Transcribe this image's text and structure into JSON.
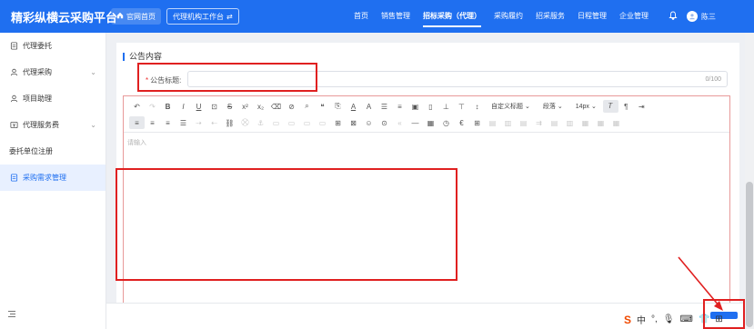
{
  "header": {
    "brand": "精彩纵横云采购平台",
    "home_btn": "官网首页",
    "workbench_btn": "代理机构工作台",
    "nav": [
      "首页",
      "销售管理",
      "招标采购（代理）",
      "采购履约",
      "招采服务",
      "日程管理",
      "企业管理"
    ],
    "active_nav_index": 2,
    "user_name": "陈三"
  },
  "sidebar": {
    "items": [
      {
        "label": "代理委托",
        "icon": "document-icon",
        "has_chevron": false
      },
      {
        "label": "代理采购",
        "icon": "user-icon",
        "has_chevron": true
      },
      {
        "label": "项目助理",
        "icon": "user-icon",
        "has_chevron": false
      },
      {
        "label": "代理服务费",
        "icon": "fee-icon",
        "has_chevron": true
      },
      {
        "label": "委托单位注册",
        "icon": "",
        "has_chevron": false
      },
      {
        "label": "采购需求管理",
        "icon": "document-icon",
        "has_chevron": false,
        "active": true
      }
    ]
  },
  "form": {
    "section_title": "公告内容",
    "title_label": "公告标题:",
    "title_value": "",
    "title_counter": "0/100",
    "editor_placeholder": "请输入",
    "toolbar": {
      "custom_title": "自定义标题",
      "paragraph": "段落",
      "font_size": "14px"
    }
  },
  "colors": {
    "primary": "#1f6ff0",
    "annotation": "#e02020"
  }
}
